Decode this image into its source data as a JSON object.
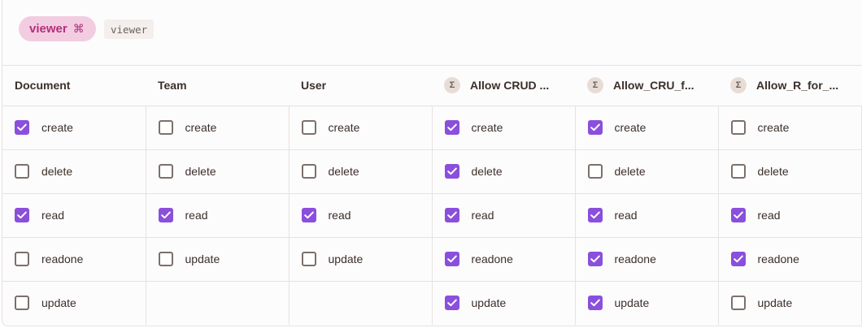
{
  "role": {
    "pill_label": "viewer",
    "pill_icon": "⌘",
    "code_label": "viewer"
  },
  "colors": {
    "accent_checkbox": "#8a4fdc",
    "pill_bg": "#f2cde1",
    "pill_text": "#b3307a"
  },
  "columns": [
    {
      "header": "Document",
      "computed": false,
      "rows": [
        {
          "label": "create",
          "checked": true
        },
        {
          "label": "delete",
          "checked": false
        },
        {
          "label": "read",
          "checked": true
        },
        {
          "label": "readone",
          "checked": false
        },
        {
          "label": "update",
          "checked": false
        }
      ]
    },
    {
      "header": "Team",
      "computed": false,
      "rows": [
        {
          "label": "create",
          "checked": false
        },
        {
          "label": "delete",
          "checked": false
        },
        {
          "label": "read",
          "checked": true
        },
        {
          "label": "update",
          "checked": false
        }
      ]
    },
    {
      "header": "User",
      "computed": false,
      "rows": [
        {
          "label": "create",
          "checked": false
        },
        {
          "label": "delete",
          "checked": false
        },
        {
          "label": "read",
          "checked": true
        },
        {
          "label": "update",
          "checked": false
        }
      ]
    },
    {
      "header": "Allow CRUD ...",
      "computed": true,
      "icon": "Σ",
      "rows": [
        {
          "label": "create",
          "checked": true
        },
        {
          "label": "delete",
          "checked": true
        },
        {
          "label": "read",
          "checked": true
        },
        {
          "label": "readone",
          "checked": true
        },
        {
          "label": "update",
          "checked": true
        }
      ]
    },
    {
      "header": "Allow_CRU_f...",
      "computed": true,
      "icon": "Σ",
      "rows": [
        {
          "label": "create",
          "checked": true
        },
        {
          "label": "delete",
          "checked": false
        },
        {
          "label": "read",
          "checked": true
        },
        {
          "label": "readone",
          "checked": true
        },
        {
          "label": "update",
          "checked": true
        }
      ]
    },
    {
      "header": "Allow_R_for_...",
      "computed": true,
      "icon": "Σ",
      "rows": [
        {
          "label": "create",
          "checked": false
        },
        {
          "label": "delete",
          "checked": false
        },
        {
          "label": "read",
          "checked": true
        },
        {
          "label": "readone",
          "checked": true
        },
        {
          "label": "update",
          "checked": false
        }
      ]
    }
  ]
}
